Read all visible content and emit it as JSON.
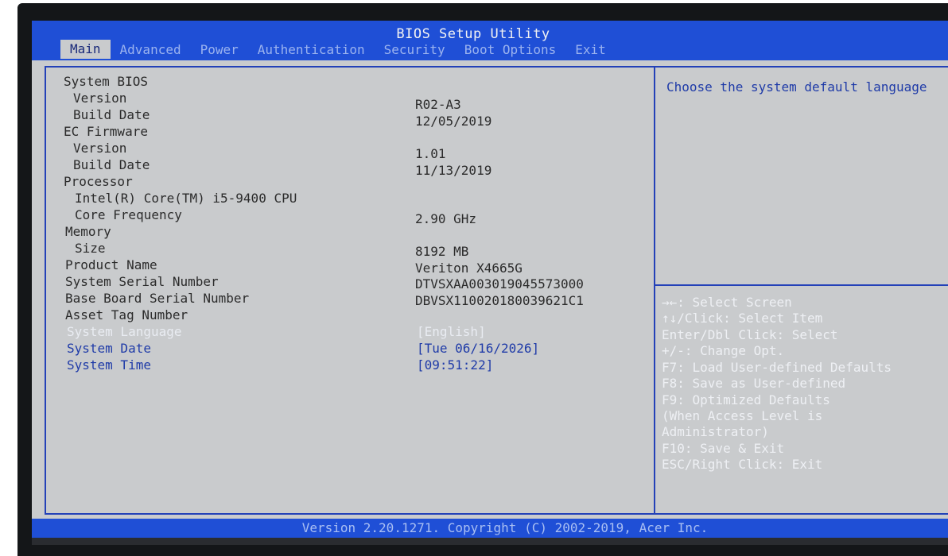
{
  "header": {
    "title": "BIOS Setup Utility",
    "tabs": [
      "Main",
      "Advanced",
      "Power",
      "Authentication",
      "Security",
      "Boot Options",
      "Exit"
    ]
  },
  "main": {
    "rows": [
      {
        "label": "System BIOS",
        "value": ""
      },
      {
        "label": "Version",
        "value": "R02-A3"
      },
      {
        "label": "Build Date",
        "value": "12/05/2019"
      },
      {
        "label": "EC Firmware",
        "value": ""
      },
      {
        "label": "Version",
        "value": "1.01"
      },
      {
        "label": "Build Date",
        "value": "11/13/2019"
      },
      {
        "label": "Processor",
        "value": ""
      },
      {
        "label": "Intel(R) Core(TM) i5-9400 CPU",
        "value": ""
      },
      {
        "label": "Core Frequency",
        "value": "2.90 GHz"
      },
      {
        "label": "Memory",
        "value": ""
      },
      {
        "label": "Size",
        "value": "8192 MB"
      },
      {
        "label": "Product Name",
        "value": "Veriton X4665G"
      },
      {
        "label": "System Serial Number",
        "value": "DTVSXAA003019045573000"
      },
      {
        "label": "Base Board Serial Number",
        "value": "DBVSX110020180039621C1"
      },
      {
        "label": "Asset Tag Number",
        "value": ""
      },
      {
        "label": "System Language",
        "value": "[English]"
      },
      {
        "label": "System Date",
        "value": "[Tue 06/16/2026]"
      },
      {
        "label": "System Time",
        "value": "[09:51:22]"
      }
    ]
  },
  "help": {
    "description": "Choose the system default language",
    "keys": [
      "→←: Select Screen",
      "↑↓/Click: Select Item",
      "Enter/Dbl Click: Select",
      "+/-: Change Opt.",
      "F7: Load User-defined Defaults",
      "F8: Save as User-defined",
      "F9: Optimized Defaults",
      "(When Access Level is",
      "Administrator)",
      "F10: Save & Exit",
      "ESC/Right Click: Exit"
    ]
  },
  "footer": {
    "text": "Version 2.20.1271. Copyright (C) 2002-2019, Acer Inc."
  },
  "colors": {
    "header_blue": "#1f4fd6",
    "panel_gray": "#c9cbcd",
    "border_blue": "#2341b8",
    "editable_text": "#1f3ba8",
    "selected_text": "#e9ecf2"
  }
}
